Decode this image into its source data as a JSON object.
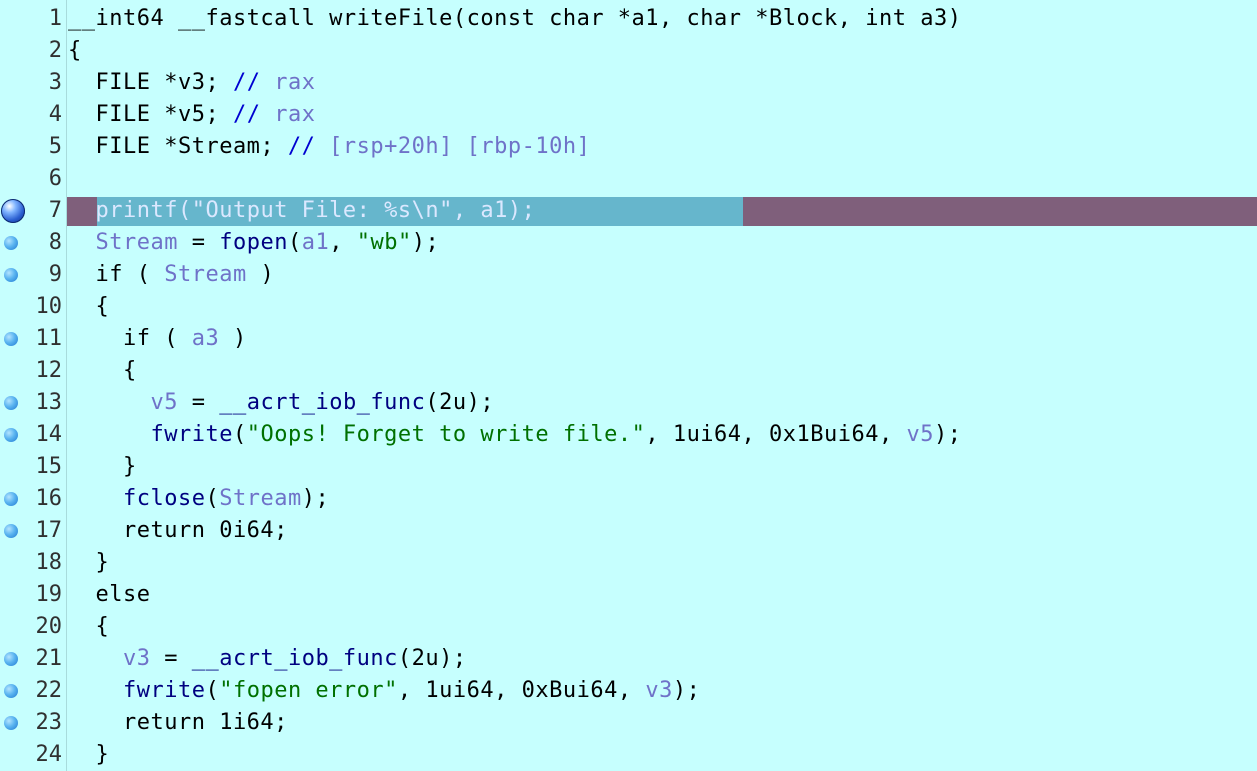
{
  "editor": {
    "lines": [
      {
        "num": "1",
        "breakpoint": "none",
        "highlight": false,
        "tokens": [
          {
            "t": "__int64 __fastcall writeFile(const char *a1, char *Block, int a3)",
            "c": "plain"
          }
        ]
      },
      {
        "num": "2",
        "breakpoint": "none",
        "highlight": false,
        "tokens": [
          {
            "t": "{",
            "c": "plain"
          }
        ]
      },
      {
        "num": "3",
        "breakpoint": "none",
        "highlight": false,
        "tokens": [
          {
            "t": "  FILE *v3; ",
            "c": "plain"
          },
          {
            "t": "// ",
            "c": "cmt"
          },
          {
            "t": "rax",
            "c": "var"
          }
        ]
      },
      {
        "num": "4",
        "breakpoint": "none",
        "highlight": false,
        "tokens": [
          {
            "t": "  FILE *v5; ",
            "c": "plain"
          },
          {
            "t": "// ",
            "c": "cmt"
          },
          {
            "t": "rax",
            "c": "var"
          }
        ]
      },
      {
        "num": "5",
        "breakpoint": "none",
        "highlight": false,
        "tokens": [
          {
            "t": "  FILE *Stream; ",
            "c": "plain"
          },
          {
            "t": "// ",
            "c": "cmt"
          },
          {
            "t": "[rsp+20h] [rbp-10h]",
            "c": "var"
          }
        ]
      },
      {
        "num": "6",
        "breakpoint": "none",
        "highlight": false,
        "tokens": []
      },
      {
        "num": "7",
        "breakpoint": "current",
        "highlight": true,
        "tokens": [
          {
            "t": "  ",
            "c": "plain"
          },
          {
            "t": "printf(",
            "c": "sel"
          },
          {
            "t": "\"Output File: %s\\n\"",
            "c": "sel"
          },
          {
            "t": ", a1);",
            "c": "sel"
          }
        ]
      },
      {
        "num": "8",
        "breakpoint": "small",
        "highlight": false,
        "tokens": [
          {
            "t": "  ",
            "c": "plain"
          },
          {
            "t": "Stream",
            "c": "var"
          },
          {
            "t": " = ",
            "c": "plain"
          },
          {
            "t": "fopen",
            "c": "fn"
          },
          {
            "t": "(",
            "c": "plain"
          },
          {
            "t": "a1",
            "c": "var"
          },
          {
            "t": ", ",
            "c": "plain"
          },
          {
            "t": "\"wb\"",
            "c": "str"
          },
          {
            "t": ");",
            "c": "plain"
          }
        ]
      },
      {
        "num": "9",
        "breakpoint": "small",
        "highlight": false,
        "tokens": [
          {
            "t": "  if ( ",
            "c": "plain"
          },
          {
            "t": "Stream",
            "c": "var"
          },
          {
            "t": " )",
            "c": "plain"
          }
        ]
      },
      {
        "num": "10",
        "breakpoint": "none",
        "highlight": false,
        "tokens": [
          {
            "t": "  {",
            "c": "plain"
          }
        ]
      },
      {
        "num": "11",
        "breakpoint": "small",
        "highlight": false,
        "tokens": [
          {
            "t": "    if ( ",
            "c": "plain"
          },
          {
            "t": "a3",
            "c": "var"
          },
          {
            "t": " )",
            "c": "plain"
          }
        ]
      },
      {
        "num": "12",
        "breakpoint": "none",
        "highlight": false,
        "tokens": [
          {
            "t": "    {",
            "c": "plain"
          }
        ]
      },
      {
        "num": "13",
        "breakpoint": "small",
        "highlight": false,
        "tokens": [
          {
            "t": "      ",
            "c": "plain"
          },
          {
            "t": "v5",
            "c": "var"
          },
          {
            "t": " = ",
            "c": "plain"
          },
          {
            "t": "__acrt_iob_func",
            "c": "fn"
          },
          {
            "t": "(2u);",
            "c": "plain"
          }
        ]
      },
      {
        "num": "14",
        "breakpoint": "small",
        "highlight": false,
        "tokens": [
          {
            "t": "      ",
            "c": "plain"
          },
          {
            "t": "fwrite",
            "c": "fn"
          },
          {
            "t": "(",
            "c": "plain"
          },
          {
            "t": "\"Oops! Forget to write file.\"",
            "c": "str"
          },
          {
            "t": ", 1ui64, 0x1Bui64, ",
            "c": "plain"
          },
          {
            "t": "v5",
            "c": "var"
          },
          {
            "t": ");",
            "c": "plain"
          }
        ]
      },
      {
        "num": "15",
        "breakpoint": "none",
        "highlight": false,
        "tokens": [
          {
            "t": "    }",
            "c": "plain"
          }
        ]
      },
      {
        "num": "16",
        "breakpoint": "small",
        "highlight": false,
        "tokens": [
          {
            "t": "    ",
            "c": "plain"
          },
          {
            "t": "fclose",
            "c": "fn"
          },
          {
            "t": "(",
            "c": "plain"
          },
          {
            "t": "Stream",
            "c": "var"
          },
          {
            "t": ");",
            "c": "plain"
          }
        ]
      },
      {
        "num": "17",
        "breakpoint": "small",
        "highlight": false,
        "tokens": [
          {
            "t": "    return 0i64;",
            "c": "plain"
          }
        ]
      },
      {
        "num": "18",
        "breakpoint": "none",
        "highlight": false,
        "tokens": [
          {
            "t": "  }",
            "c": "plain"
          }
        ]
      },
      {
        "num": "19",
        "breakpoint": "none",
        "highlight": false,
        "tokens": [
          {
            "t": "  else",
            "c": "plain"
          }
        ]
      },
      {
        "num": "20",
        "breakpoint": "none",
        "highlight": false,
        "tokens": [
          {
            "t": "  {",
            "c": "plain"
          }
        ]
      },
      {
        "num": "21",
        "breakpoint": "small",
        "highlight": false,
        "tokens": [
          {
            "t": "    ",
            "c": "plain"
          },
          {
            "t": "v3",
            "c": "var"
          },
          {
            "t": " = ",
            "c": "plain"
          },
          {
            "t": "__acrt_iob_func",
            "c": "fn"
          },
          {
            "t": "(2u);",
            "c": "plain"
          }
        ]
      },
      {
        "num": "22",
        "breakpoint": "small",
        "highlight": false,
        "tokens": [
          {
            "t": "    ",
            "c": "plain"
          },
          {
            "t": "fwrite",
            "c": "fn"
          },
          {
            "t": "(",
            "c": "plain"
          },
          {
            "t": "\"fopen error\"",
            "c": "str"
          },
          {
            "t": ", 1ui64, 0xBui64, ",
            "c": "plain"
          },
          {
            "t": "v3",
            "c": "var"
          },
          {
            "t": ");",
            "c": "plain"
          }
        ]
      },
      {
        "num": "23",
        "breakpoint": "small",
        "highlight": false,
        "tokens": [
          {
            "t": "    return 1i64;",
            "c": "plain"
          }
        ]
      },
      {
        "num": "24",
        "breakpoint": "none",
        "highlight": false,
        "tokens": [
          {
            "t": "  }",
            "c": "plain"
          }
        ]
      }
    ]
  },
  "colors": {
    "background": "#c6fffe",
    "current_line": "#7f5f7b",
    "selection": "#66b6cc",
    "variable": "#6f72c8",
    "function": "#000080",
    "string": "#007000",
    "comment": "#0000d0"
  },
  "icons": {
    "current_breakpoint": "execution-breakpoint-icon",
    "breakpoint": "breakpoint-dot-icon"
  }
}
